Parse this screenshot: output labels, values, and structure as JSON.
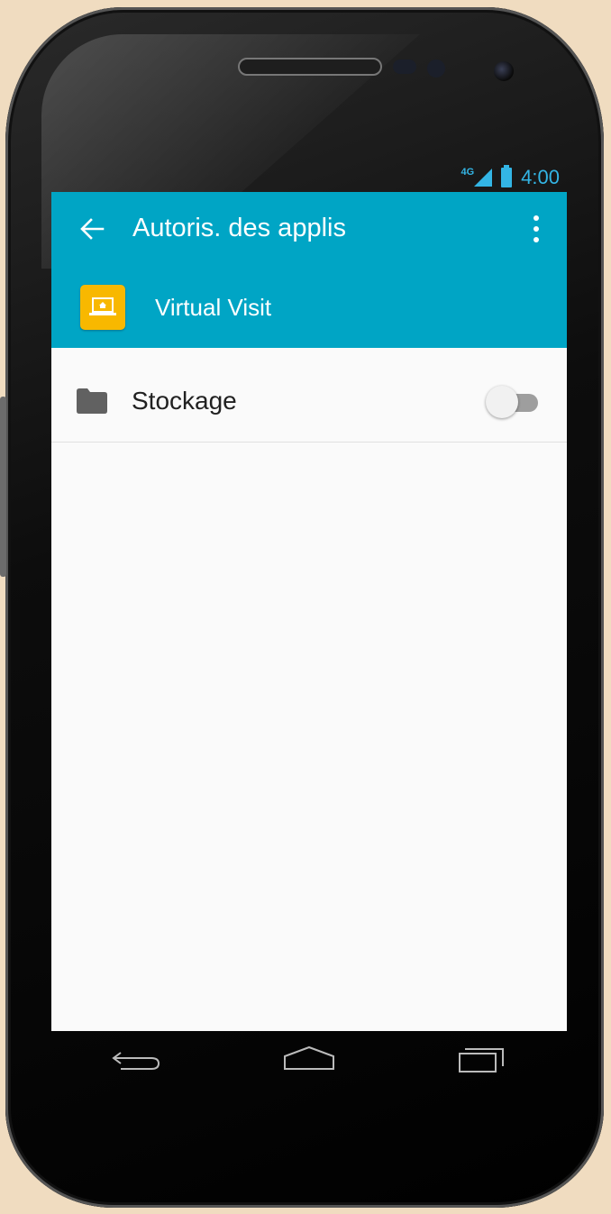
{
  "statusbar": {
    "network": "4G",
    "time": "4:00"
  },
  "appbar": {
    "title": "Autoris. des applis",
    "app_name": "Virtual Visit",
    "background": "#00a5c5"
  },
  "permissions": [
    {
      "label": "Stockage",
      "icon": "folder-icon",
      "enabled": false
    }
  ],
  "navbar": {
    "buttons": [
      "back-nav-icon",
      "home-nav-icon",
      "recent-apps-icon"
    ]
  },
  "colors": {
    "accent": "#33b5e5",
    "app_icon": "#f8b800"
  }
}
